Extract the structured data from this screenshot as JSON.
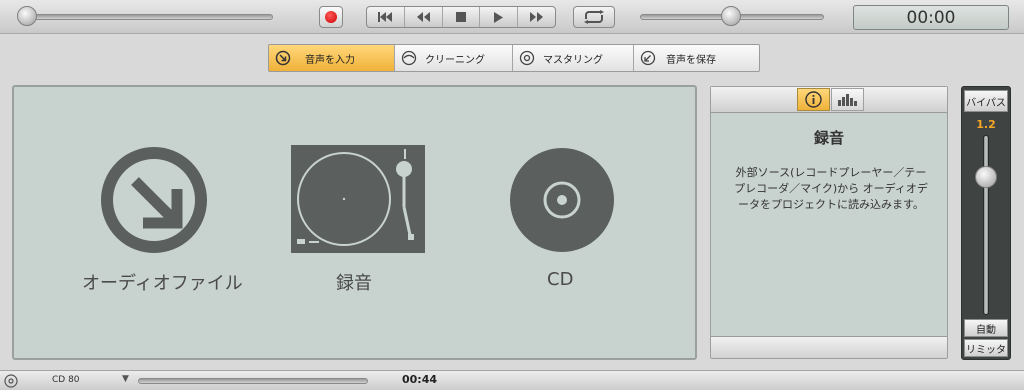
{
  "transport": {
    "time": "00:00"
  },
  "tabs": [
    {
      "label": "音声を入力",
      "icon": "import-arrow-icon",
      "active": true
    },
    {
      "label": "クリーニング",
      "icon": "clean-icon",
      "active": false
    },
    {
      "label": "マスタリング",
      "icon": "mastering-icon",
      "active": false
    },
    {
      "label": "音声を保存",
      "icon": "save-icon",
      "active": false
    }
  ],
  "sources": [
    {
      "label": "オーディオファイル",
      "icon": "audio-file-icon"
    },
    {
      "label": "録音",
      "icon": "turntable-icon"
    },
    {
      "label": "CD",
      "icon": "cd-icon"
    }
  ],
  "info": {
    "title": "録音",
    "text": "外部ソース(レコードプレーヤー／テープレコーダ／マイク)から オーディオデータをプロジェクトに読み込みます。"
  },
  "limiter": {
    "bypass_label": "バイパス",
    "value": "1.2",
    "auto_label": "自動",
    "limiter_label": "リミッタ"
  },
  "status": {
    "disc_type": "CD 80",
    "time": "00:44"
  },
  "colors": {
    "accent": "#f0b23a",
    "panel": "#c8d2cf",
    "icon_gray": "#5b605e"
  }
}
